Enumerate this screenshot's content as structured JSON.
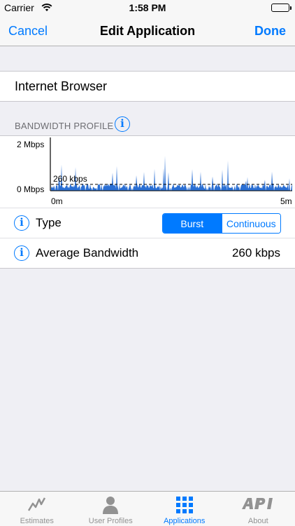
{
  "status_bar": {
    "carrier": "Carrier",
    "time": "1:58 PM"
  },
  "nav": {
    "cancel_label": "Cancel",
    "title": "Edit Application",
    "done_label": "Done"
  },
  "app_name": {
    "value": "Internet Browser"
  },
  "bandwidth_profile": {
    "section_title": "BANDWIDTH PROFILE",
    "info_glyph": "i"
  },
  "chart_data": {
    "type": "area",
    "y_tick_labels": [
      "2 Mbps",
      "0 Mbps"
    ],
    "x_tick_labels": [
      "0m",
      "5m"
    ],
    "ylim": [
      0,
      2000
    ],
    "xlim": [
      0,
      5
    ],
    "reference_line": {
      "value": 260,
      "label": "260 kbps"
    },
    "series_color": "#2a6fd4",
    "grid": false
  },
  "type_row": {
    "label": "Type",
    "options": [
      "Burst",
      "Continuous"
    ],
    "selected": "Burst"
  },
  "avg_row": {
    "label": "Average Bandwidth",
    "value": "260",
    "unit": "kbps"
  },
  "tabs": [
    {
      "label": "Estimates",
      "icon": "chart-line-icon"
    },
    {
      "label": "User Profiles",
      "icon": "person-icon"
    },
    {
      "label": "Applications",
      "icon": "grid-icon",
      "active": true
    },
    {
      "label": "About",
      "icon": "api-logo-icon"
    }
  ],
  "colors": {
    "accent": "#007aff",
    "background": "#efeff4"
  }
}
